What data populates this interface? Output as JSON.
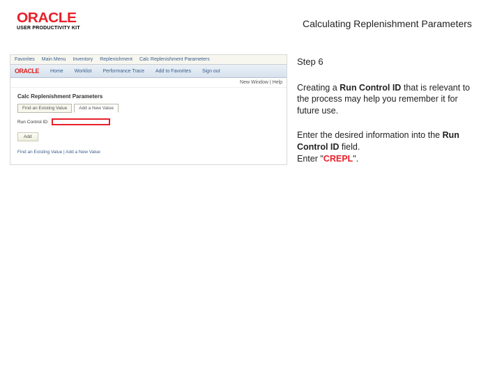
{
  "header": {
    "logo_text": "ORACLE",
    "logo_sub": "USER PRODUCTIVITY KIT",
    "title": "Calculating Replenishment Parameters"
  },
  "screenshot": {
    "top_nav": [
      "Favorites",
      "Main Menu",
      "Inventory",
      "Replenishment",
      "Calc Replenishment Parameters"
    ],
    "brand": "ORACLE",
    "brand_nav": [
      "Home",
      "Worklist",
      "Performance Trace",
      "Add to Favorites",
      "Sign out"
    ],
    "underbar": "New Window  |  Help",
    "heading": "Calc Replenishment Parameters",
    "tabs": [
      "Find an Existing Value",
      "Add a New Value"
    ],
    "field_label": "Run Control ID:",
    "add_btn": "Add",
    "footer": "Find an Existing Value  |  Add a New Value"
  },
  "side": {
    "step": "Step 6",
    "p1_a": "Creating a ",
    "p1_b": "Run Control ID",
    "p1_c": " that is relevant to the process may help you remember it for future use.",
    "p2_a": "Enter the desired information into the ",
    "p2_b": "Run Control ID",
    "p2_c": " field.",
    "p3_a": "Enter \"",
    "p3_b": "CREPL",
    "p3_c": "\"."
  }
}
